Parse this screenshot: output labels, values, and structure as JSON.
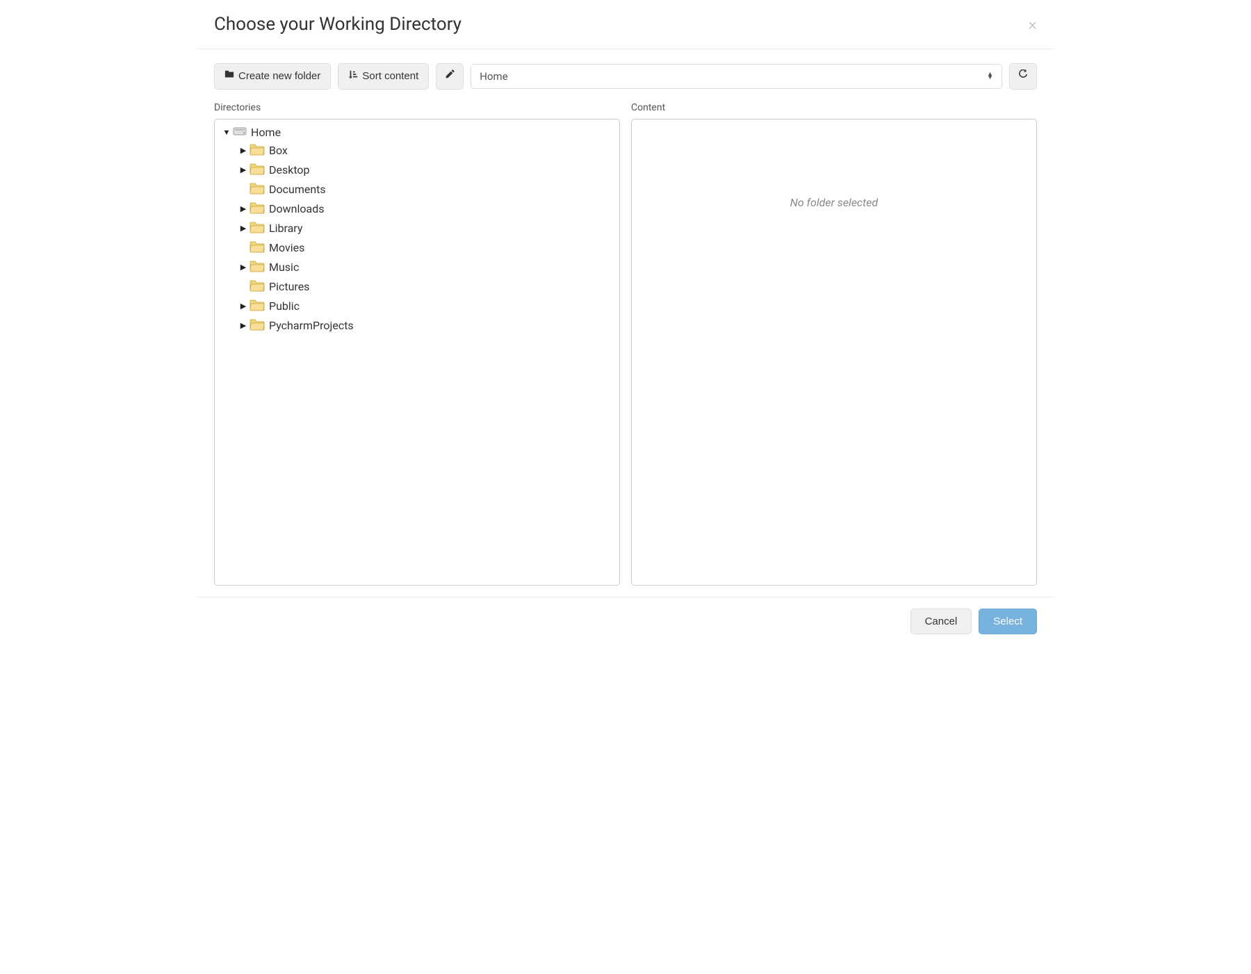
{
  "dialog": {
    "title": "Choose your Working Directory"
  },
  "toolbar": {
    "create_folder_label": "Create new folder",
    "sort_content_label": "Sort content",
    "path_value": "Home"
  },
  "panels": {
    "directories_label": "Directories",
    "content_label": "Content",
    "content_empty_text": "No folder selected"
  },
  "tree": {
    "root": {
      "label": "Home",
      "expanded": true,
      "type": "drive"
    },
    "children": [
      {
        "label": "Box",
        "has_children": true
      },
      {
        "label": "Desktop",
        "has_children": true
      },
      {
        "label": "Documents",
        "has_children": false
      },
      {
        "label": "Downloads",
        "has_children": true
      },
      {
        "label": "Library",
        "has_children": true
      },
      {
        "label": "Movies",
        "has_children": false
      },
      {
        "label": "Music",
        "has_children": true
      },
      {
        "label": "Pictures",
        "has_children": false
      },
      {
        "label": "Public",
        "has_children": true
      },
      {
        "label": "PycharmProjects",
        "has_children": true
      }
    ]
  },
  "footer": {
    "cancel_label": "Cancel",
    "select_label": "Select"
  }
}
